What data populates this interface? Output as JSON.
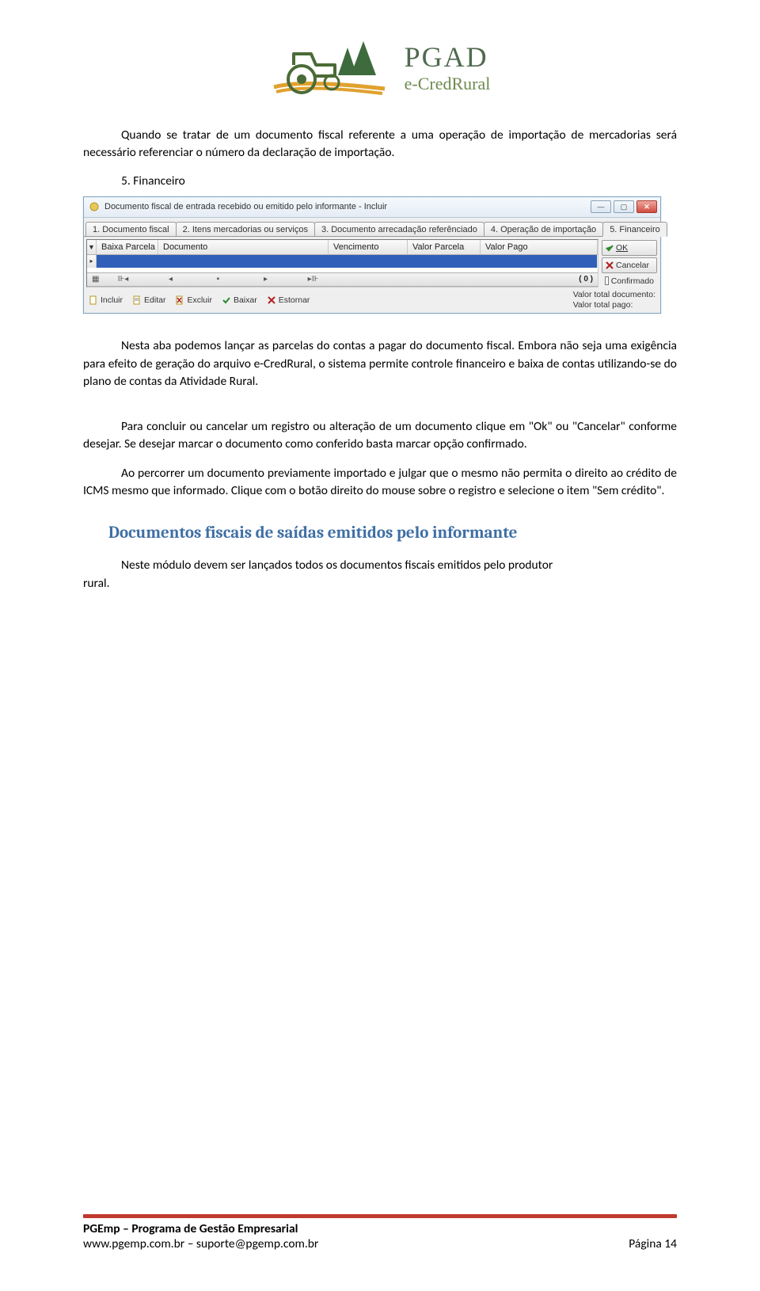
{
  "header": {
    "brand_top": "PGAD",
    "brand_sub": "e-CredRural"
  },
  "doc": {
    "p1": "Quando se tratar de um documento fiscal referente a uma operação de importação de mercadorias será necessário referenciar o número da declaração de importação.",
    "list5": "5. Financeiro",
    "p2": "Nesta aba podemos lançar as parcelas do contas a pagar do documento fiscal. Embora não seja uma exigência para efeito de geração do arquivo e-CredRural, o sistema permite controle financeiro e baixa de contas utilizando-se do plano de contas da Atividade Rural.",
    "p3": "Para concluir ou cancelar um registro ou alteração de um documento clique em \"Ok\" ou \"Cancelar\" conforme desejar. Se desejar marcar o documento como conferido basta marcar opção confirmado.",
    "p4": "Ao percorrer um documento previamente importado e julgar que o mesmo não permita o direito ao crédito de ICMS mesmo que informado. Clique com o botão direito do mouse sobre o registro e selecione o item \"Sem crédito\".",
    "h2": "Documentos fiscais de saídas emitidos pelo informante",
    "p5_pre": "rural.",
    "p5": "Neste módulo devem ser lançados todos os documentos fiscais emitidos pelo produtor"
  },
  "win": {
    "title": "Documento fiscal de entrada recebido ou emitido pelo informante - Incluir",
    "tabs": [
      "1. Documento fiscal",
      "2. Itens mercadorias ou serviços",
      "3. Documento arrecadação referênciado",
      "4. Operação de importação",
      "5. Financeiro"
    ],
    "cols": {
      "baixa": "Baixa Parcela",
      "doc": "Documento",
      "venc": "Vencimento",
      "vp": "Valor Parcela",
      "pago": "Valor Pago"
    },
    "row_marker_down": "▼",
    "row_marker_cursor": "▸",
    "btn_ok": "OK",
    "btn_cancel": "Cancelar",
    "chk_conf": "Confirmado",
    "nav_count": "( 0 )",
    "tb": {
      "incluir": "Incluir",
      "editar": "Editar",
      "excluir": "Excluir",
      "baixar": "Baixar",
      "estornar": "Estornar"
    },
    "totals1": "Valor total documento:",
    "totals2": "Valor total pago:"
  },
  "footer": {
    "l1": "PGEmp – Programa de Gestão Empresarial",
    "l2": "www.pgemp.com.br – suporte@pgemp.com.br",
    "page": "Página 14"
  }
}
